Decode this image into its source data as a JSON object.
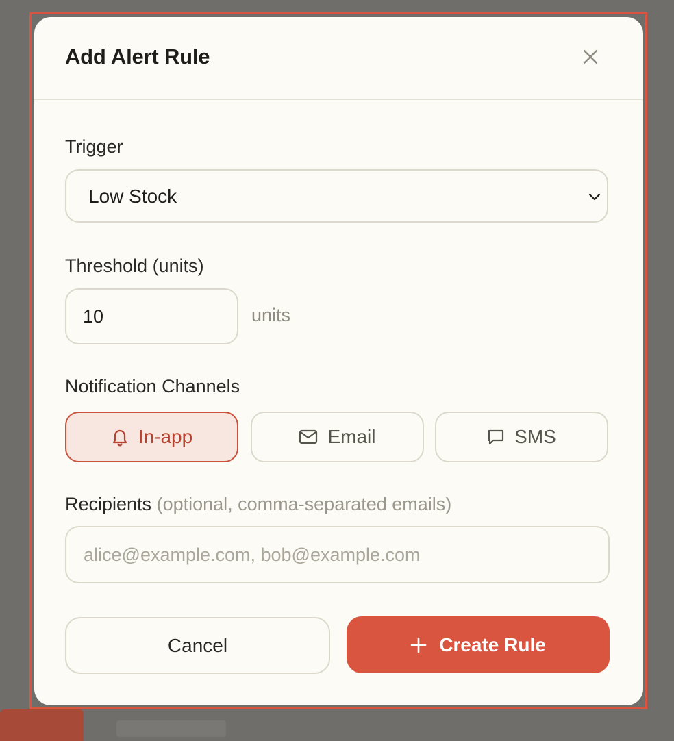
{
  "dialog": {
    "title": "Add Alert Rule",
    "close_icon": "close-icon"
  },
  "trigger": {
    "label": "Trigger",
    "selected": "Low Stock",
    "chevron_icon": "chevron-down-icon"
  },
  "threshold": {
    "label": "Threshold (units)",
    "value": "10",
    "suffix": "units"
  },
  "channels": {
    "label": "Notification Channels",
    "items": [
      {
        "label": "In-app",
        "icon": "bell-icon",
        "selected": true
      },
      {
        "label": "Email",
        "icon": "mail-icon",
        "selected": false
      },
      {
        "label": "SMS",
        "icon": "message-icon",
        "selected": false
      }
    ]
  },
  "recipients": {
    "label": "Recipients",
    "hint": "(optional, comma-separated emails)",
    "placeholder": "alice@example.com, bob@example.com",
    "value": ""
  },
  "actions": {
    "cancel_label": "Cancel",
    "create_label": "Create Rule",
    "create_icon": "plus-icon"
  },
  "colors": {
    "accent": "#d9553f",
    "accent_soft": "#f8e6e0",
    "surface": "#fcfbf6",
    "border": "#dcd8cb",
    "backdrop": "#6f6e6b"
  }
}
